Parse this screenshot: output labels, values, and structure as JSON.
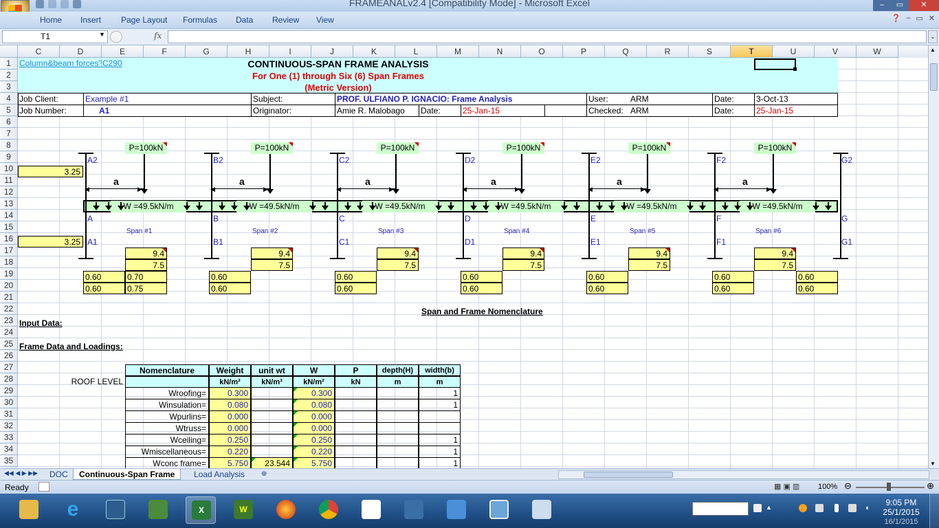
{
  "app": {
    "title": "FRAMEANALv2.4  [Compatibility Mode]  -  Microsoft Excel"
  },
  "ribbon": {
    "tabs": [
      "Home",
      "Insert",
      "Page Layout",
      "Formulas",
      "Data",
      "Review",
      "View"
    ]
  },
  "formula_bar": {
    "name_box": "T1",
    "fx_label": "fx",
    "formula": ""
  },
  "columns": [
    "C",
    "D",
    "E",
    "F",
    "G",
    "H",
    "I",
    "J",
    "K",
    "L",
    "M",
    "N",
    "O",
    "P",
    "Q",
    "R",
    "S",
    "T",
    "U",
    "V",
    "W"
  ],
  "selected_column": "T",
  "rows": [
    "1",
    "2",
    "3",
    "4",
    "5",
    "6",
    "7",
    "8",
    "9",
    "10",
    "11",
    "12",
    "13",
    "14",
    "15",
    "16",
    "17",
    "18",
    "19",
    "20",
    "21",
    "22",
    "23",
    "24",
    "25",
    "26",
    "27",
    "28",
    "29",
    "30",
    "31",
    "32",
    "33",
    "34",
    "35"
  ],
  "sheet": {
    "link": "Column&beam forces'!C290",
    "title1": "CONTINUOUS-SPAN FRAME ANALYSIS",
    "title2": "For One (1) through Six (6) Span Frames",
    "title3": "(Metric Version)",
    "job_client_label": "Job Client:",
    "job_client": "Example #1",
    "job_number_label": "Job Number:",
    "job_number": "A1",
    "subject_label": "Subject:",
    "subject": "PROF. ULFIANO P. IGNACIO:  Frame Analysis",
    "originator_label": "Originator:",
    "originator": "Amie R. Malobago",
    "date_label": "Date:",
    "date1": "25-Jan-15",
    "user_label": "User:",
    "user": "ARM",
    "date_label2": "Date:",
    "date2": "3-Oct-13",
    "checked_label": "Checked:",
    "checked": "ARM",
    "date_label3": "Date:",
    "date3": "25-Jan-15",
    "height_top": "3.25",
    "height_bottom": "3.25",
    "load_p": "P=100kN",
    "load_w": "W =49.5kN/m",
    "a_label": "a",
    "top_nodes": [
      "A2",
      "B2",
      "C2",
      "D2",
      "E2",
      "F2",
      "G2"
    ],
    "beam_nodes": [
      "A",
      "B",
      "C",
      "D",
      "E",
      "F",
      "G"
    ],
    "bottom_nodes": [
      "A1",
      "B1",
      "C1",
      "D1",
      "E1",
      "F1",
      "G1"
    ],
    "spans": [
      "Span #1",
      "Span #2",
      "Span #3",
      "Span #4",
      "Span #5",
      "Span #6"
    ],
    "span_length": "9.4",
    "a_value": "7.5",
    "col_b_top": "0.60",
    "col_b_bot": "0.60",
    "beam_b": "0.70",
    "beam_d": "0.75",
    "nomenclature_caption": "Span and Frame Nomenclature",
    "input_data": "Input Data:",
    "frame_data": "Frame Data and Loadings:",
    "roof_level": "ROOF LEVEL",
    "table_headers": [
      "Nomenclature",
      "Weight",
      "unit wt",
      "W",
      "P",
      "depth(H)",
      "width(b)"
    ],
    "table_units": [
      "",
      "kN/m²",
      "kN/m³",
      "kN/m²",
      "kN",
      "m",
      "m"
    ],
    "table_rows": [
      {
        "name": "Wroofing=",
        "weight": "0.300",
        "unit": "",
        "w": "0.300",
        "p": "",
        "d": "",
        "b": "1"
      },
      {
        "name": "Winsulation=",
        "weight": "0.080",
        "unit": "",
        "w": "0.080",
        "p": "",
        "d": "",
        "b": "1"
      },
      {
        "name": "Wpurlins=",
        "weight": "0.000",
        "unit": "",
        "w": "0.000",
        "p": "",
        "d": "",
        "b": ""
      },
      {
        "name": "Wtruss=",
        "weight": "0.000",
        "unit": "",
        "w": "0.000",
        "p": "",
        "d": "",
        "b": ""
      },
      {
        "name": "Wceiling=",
        "weight": "0.250",
        "unit": "",
        "w": "0.250",
        "p": "",
        "d": "",
        "b": "1"
      },
      {
        "name": "Wmiscellaneous=",
        "weight": "0.220",
        "unit": "",
        "w": "0.220",
        "p": "",
        "d": "",
        "b": "1"
      },
      {
        "name": "Wconc frame=",
        "weight": "5.750",
        "unit": "23.544",
        "w": "5.750",
        "p": "",
        "d": "",
        "b": "1"
      }
    ]
  },
  "sheet_tabs": [
    "DOC",
    "Continuous-Span Frame",
    "Load Analysis"
  ],
  "active_tab": "Continuous-Span Frame",
  "status": {
    "ready": "Ready",
    "zoom": "100%"
  },
  "taskbar": {
    "time": "9:05 PM",
    "date1": "25/1/2015",
    "date2": "16/1/2015"
  }
}
